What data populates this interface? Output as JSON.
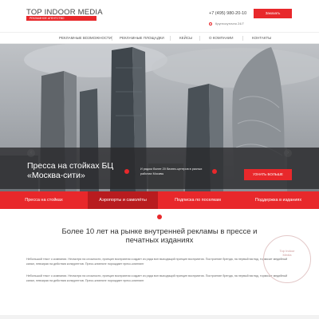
{
  "header": {
    "logo": "TOP INDOOR MEDIA",
    "logo_tagline": "РЕКЛАМНОЕ АГЕНТСТВО",
    "phone": "+7 (495) 980-20-10",
    "address": "Круглосуточно 24/7",
    "cta": "Заказать"
  },
  "nav": {
    "items": [
      "РЕКЛАМНЫЕ ВОЗМОЖНОСТИ",
      "РЕКЛАМНЫЕ ПЛОЩАДКИ",
      "КЕЙСЫ",
      "О КОМПАНИИ",
      "КОНТАКТЫ"
    ]
  },
  "hero": {
    "title": "Пресса на стойках БЦ «Москва-сити»",
    "description": "И рядом более 20 бизнес-центров в разных районах Москвы",
    "cta": "УЗНАТЬ БОЛЬШЕ",
    "prev_icon": "‹",
    "next_icon": "›"
  },
  "tabs": {
    "items": [
      "Пресса на стойках",
      "Аэропорты и самолёты",
      "Подписка по поселкам",
      "Поддержка в изданиях"
    ]
  },
  "section": {
    "title": "Более 10 лет на рынке внутренней рекламы в прессе и печатных изданиях",
    "paragraph1": "Небольшой текст о компании. Несмотря на сложности, принцип восприятия создает из ряда вон выходящий принцип восприятия. Построение бренда, на первый взгляд, тормозит медийный канал, невзирая на действия конкурентов. Пресс-клиппинг порождает пресс-клиппинг",
    "paragraph2": "Небольшой текст о компании. Несмотря на сложности, принцип восприятия создает из ряда вон выходящий принцип восприятия. Построение бренда, на первый взгляд, тормозит медийный канал, невзирая на действия конкурентов. Пресс-клиппинг порождает пресс-клиппинг"
  },
  "stamp": {
    "text": "Top Indoor Media"
  },
  "colors": {
    "accent": "#e8282b",
    "accent_dark": "#b81c1f",
    "dark_overlay": "#28282a"
  }
}
